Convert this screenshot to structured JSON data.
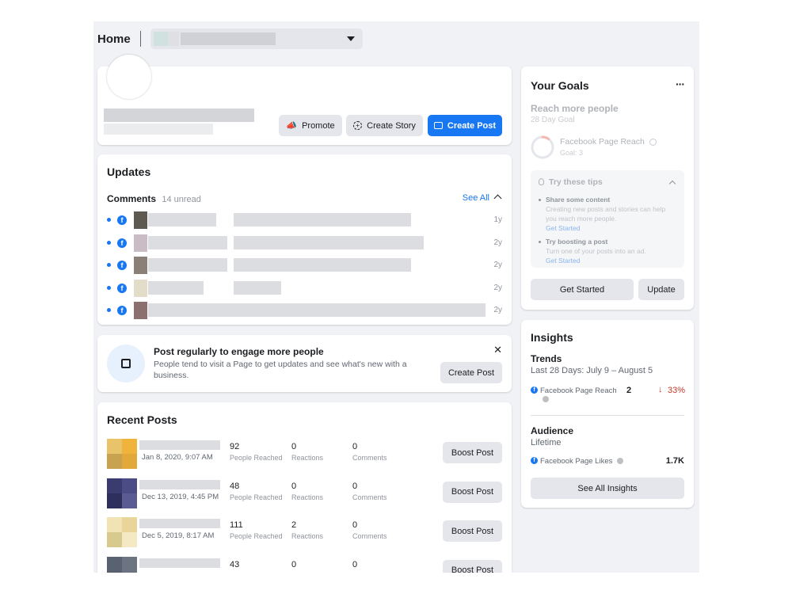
{
  "topbar": {
    "title": "Home"
  },
  "profile": {
    "promote_label": "Promote",
    "create_story_label": "Create Story",
    "create_post_label": "Create Post"
  },
  "updates": {
    "title": "Updates",
    "comments_label": "Comments",
    "unread": "14 unread",
    "see_all": "See All",
    "rows": [
      {
        "time": "1y"
      },
      {
        "time": "2y"
      },
      {
        "time": "2y"
      },
      {
        "time": "2y"
      },
      {
        "time": "2y"
      }
    ]
  },
  "tip": {
    "title": "Post regularly to engage more people",
    "body": "People tend to visit a Page to get updates and see what's new with a business.",
    "button": "Create Post"
  },
  "recent_posts": {
    "title": "Recent Posts",
    "labels": {
      "reached": "People Reached",
      "reactions": "Reactions",
      "comments": "Comments",
      "boost": "Boost Post"
    },
    "posts": [
      {
        "date": "Jan 8, 2020, 9:07 AM",
        "reached": "92",
        "reactions": "0",
        "comments": "0",
        "thumb": [
          "#e8c36a",
          "#f0b43c",
          "#c9a24f",
          "#e2a83a"
        ]
      },
      {
        "date": "Dec 13, 2019, 4:45 PM",
        "reached": "48",
        "reactions": "0",
        "comments": "0",
        "thumb": [
          "#3a3b6e",
          "#4b4c86",
          "#2e2f5c",
          "#5a5b92"
        ]
      },
      {
        "date": "Dec 5, 2019, 8:17 AM",
        "reached": "111",
        "reactions": "2",
        "comments": "0",
        "thumb": [
          "#f2e3b5",
          "#e9d49a",
          "#d8c98f",
          "#f5e9c4"
        ]
      },
      {
        "date": "",
        "reached": "43",
        "reactions": "0",
        "comments": "0",
        "thumb": [
          "#596270",
          "#6c7482",
          "#505866",
          "#646c78"
        ]
      }
    ]
  },
  "goals": {
    "title": "Your Goals",
    "more": "···",
    "goal_title": "Reach more people",
    "goal_sub": "28 Day Goal",
    "metric": "Facebook Page Reach",
    "metric_goal": "Goal: 3",
    "progress": 0.1,
    "tips_title": "Try these tips",
    "tips": [
      {
        "title": "Share some content",
        "body": "Creating new posts and stories can help you reach more people.",
        "link": "Get Started"
      },
      {
        "title": "Try boosting a post",
        "body": "Turn one of your posts into an ad.",
        "link": "Get Started"
      }
    ],
    "get_started": "Get Started",
    "update": "Update"
  },
  "insights": {
    "title": "Insights",
    "trends": "Trends",
    "trends_range": "Last 28 Days: July 9 – August 5",
    "reach_label": "Facebook Page Reach",
    "reach_value": "2",
    "reach_change": "33%",
    "audience": "Audience",
    "lifetime": "Lifetime",
    "likes_label": "Facebook Page Likes",
    "likes_value": "1.7K",
    "see_all": "See All Insights"
  },
  "colors": {
    "accent": "#1877f2",
    "down": "#c0392b",
    "bg": "#f0f2f5"
  }
}
